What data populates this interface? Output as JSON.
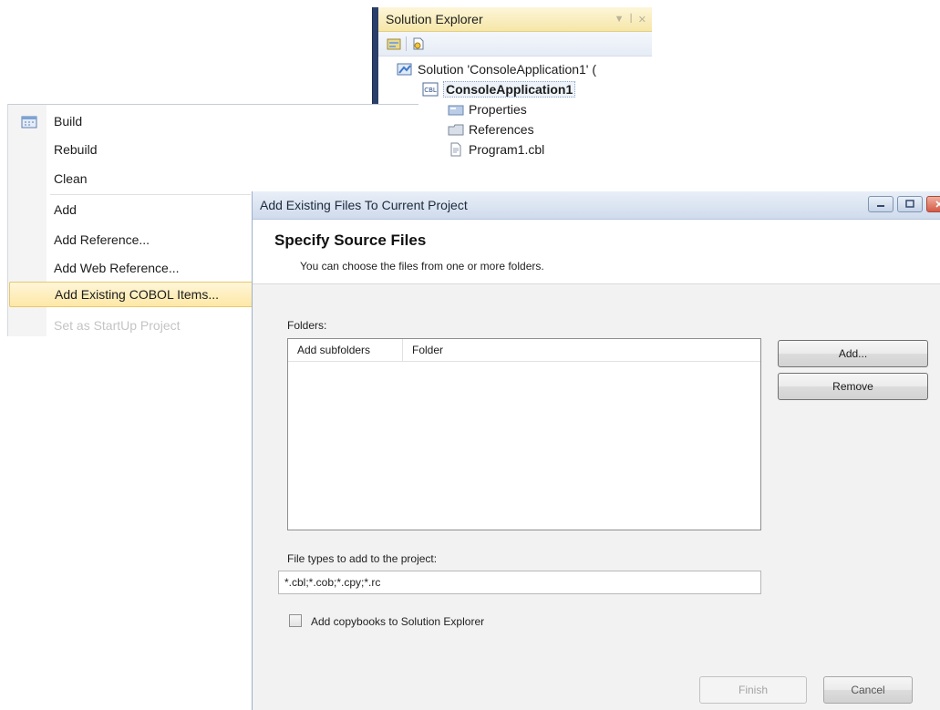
{
  "solution_explorer": {
    "title": "Solution Explorer",
    "pin_glyph": "▾ ꟾ ✕",
    "toolbar": {
      "icons": [
        "properties-icon",
        "show-all-files-icon"
      ]
    },
    "tree": {
      "solution": "Solution 'ConsoleApplication1' (",
      "project": "ConsoleApplication1",
      "properties": "Properties",
      "references": "References",
      "program": "Program1.cbl"
    }
  },
  "context_menu": {
    "items": {
      "build": "Build",
      "rebuild": "Rebuild",
      "clean": "Clean",
      "add": "Add",
      "add_reference": "Add Reference...",
      "add_web_reference": "Add Web Reference...",
      "add_existing_cobol": "Add Existing COBOL Items...",
      "set_startup": "Set as StartUp Project"
    }
  },
  "dialog": {
    "title": "Add Existing Files To Current Project",
    "heading": "Specify Source Files",
    "subheading": "You can choose the files from one or more folders.",
    "folders_label": "Folders:",
    "columns": {
      "add_subfolders": "Add subfolders",
      "folder": "Folder"
    },
    "add_button": "Add...",
    "remove_button": "Remove",
    "file_types_label": "File types to add to the project:",
    "file_types_value": "*.cbl;*.cob;*.cpy;*.rc",
    "copybooks_label": "Add copybooks to Solution Explorer",
    "finish_button": "Finish",
    "cancel_button": "Cancel"
  },
  "colors": {
    "menu_highlight": "#fde8a6",
    "dialog_title_bar": "#cfdbec",
    "solution_explorer_title": "#f6e6a8"
  }
}
